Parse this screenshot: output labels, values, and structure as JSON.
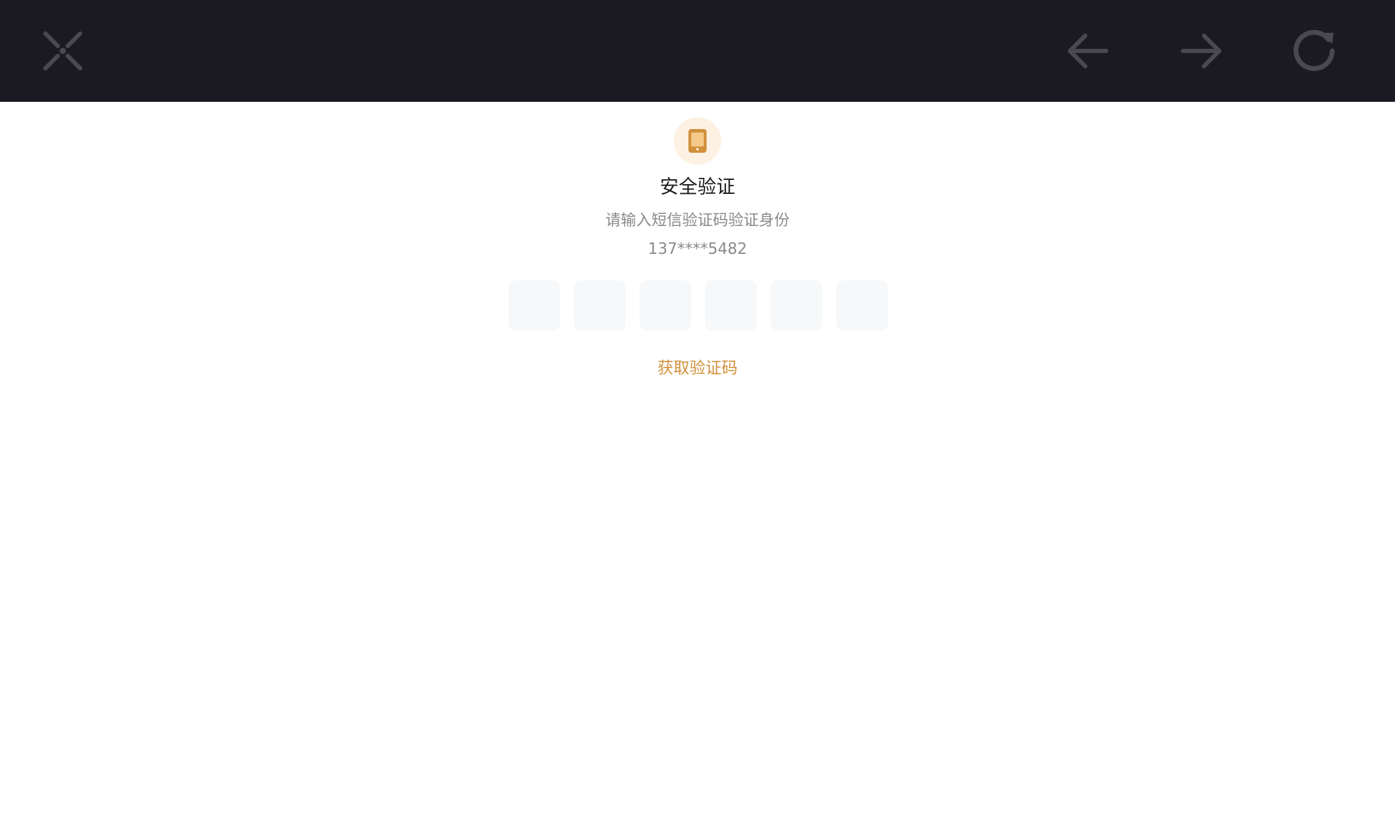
{
  "toolbar": {
    "close_icon": "close-icon",
    "back_icon": "arrow-left-icon",
    "forward_icon": "arrow-right-icon",
    "reload_icon": "reload-icon",
    "background_color": "#1b1a22",
    "icon_color": "#4a4950"
  },
  "verification": {
    "icon": "phone-icon",
    "icon_background": "#fdf1e3",
    "icon_color": "#d1913c",
    "title": "安全验证",
    "subtitle": "请输入短信验证码验证身份",
    "phone_number": "137****5482",
    "code_inputs": [
      "",
      "",
      "",
      "",
      "",
      ""
    ],
    "get_code_label": "获取验证码",
    "accent_color": "#d1913c"
  }
}
